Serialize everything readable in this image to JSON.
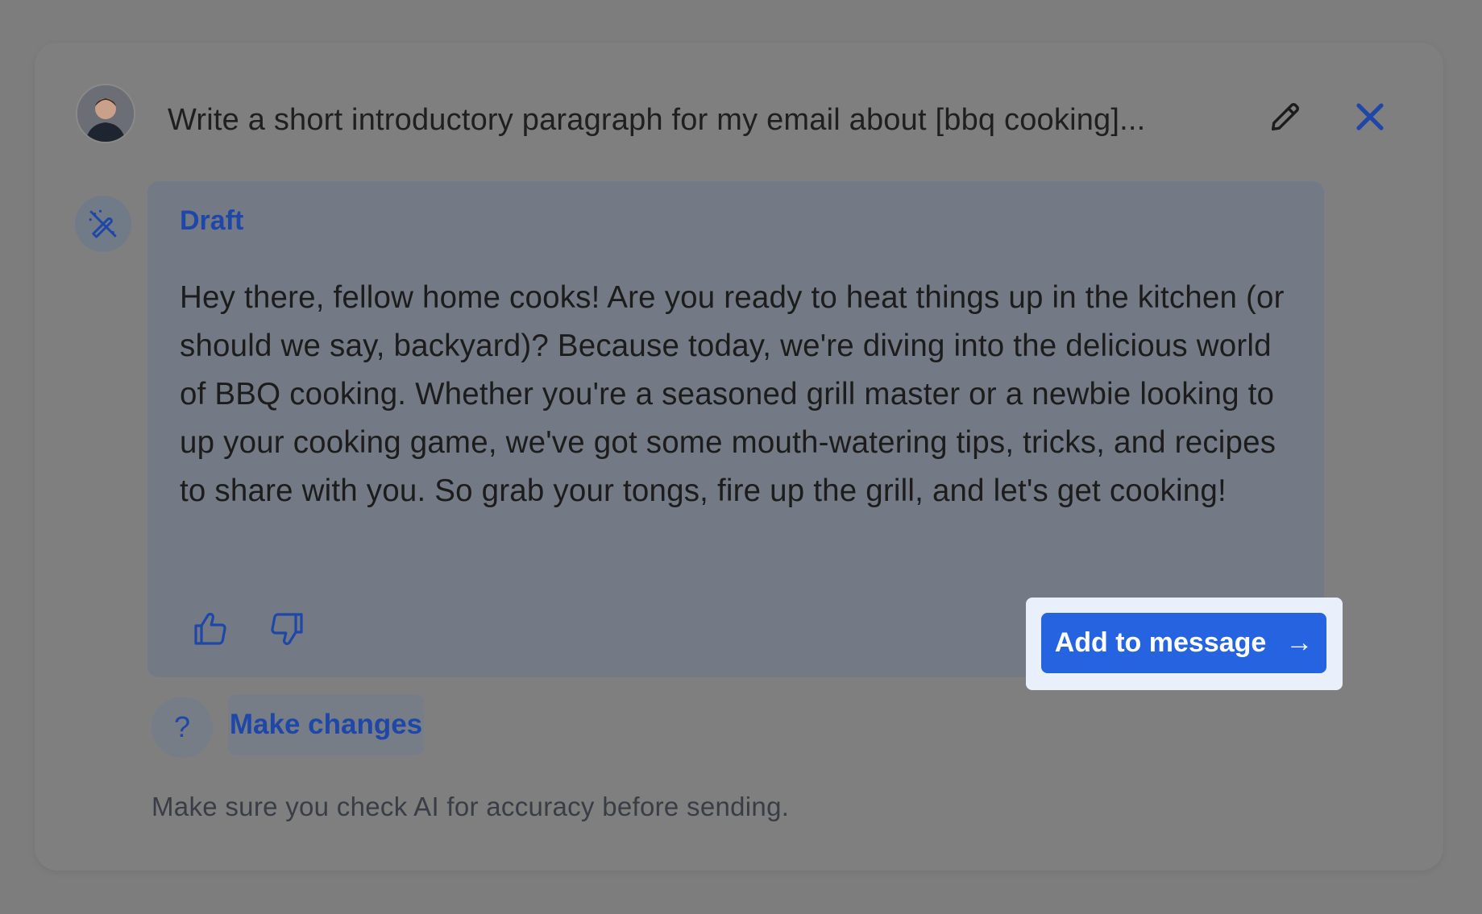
{
  "header": {
    "prompt": "Write a short introductory paragraph for my email about [bbq cooking]..."
  },
  "draft": {
    "label": "Draft",
    "body": "Hey there, fellow home cooks! Are you ready to heat things up in the kitchen (or should we say, backyard)? Because today, we're diving into the delicious world of BBQ cooking. Whether you're a seasoned grill master or a newbie looking to up your cooking game, we've got some mouth-watering tips, tricks, and recipes to share with you. So grab your tongs, fire up the grill, and let's get cooking!",
    "add_button_label": "Add to message",
    "add_button_arrow": "→"
  },
  "actions": {
    "help_label": "?",
    "make_changes_label": "Make changes"
  },
  "footer": {
    "disclaimer": "Make sure you check AI for accuracy before sending."
  },
  "icons": {
    "avatar": "user-avatar",
    "edit": "pencil-icon",
    "close": "close-icon",
    "draft": "magic-wand-icon",
    "thumbs_up": "thumbs-up-icon",
    "thumbs_down": "thumbs-down-icon"
  },
  "colors": {
    "accent": "#1f47a8",
    "primary_button": "#2563e0",
    "overlay": "#7d7d7d"
  }
}
